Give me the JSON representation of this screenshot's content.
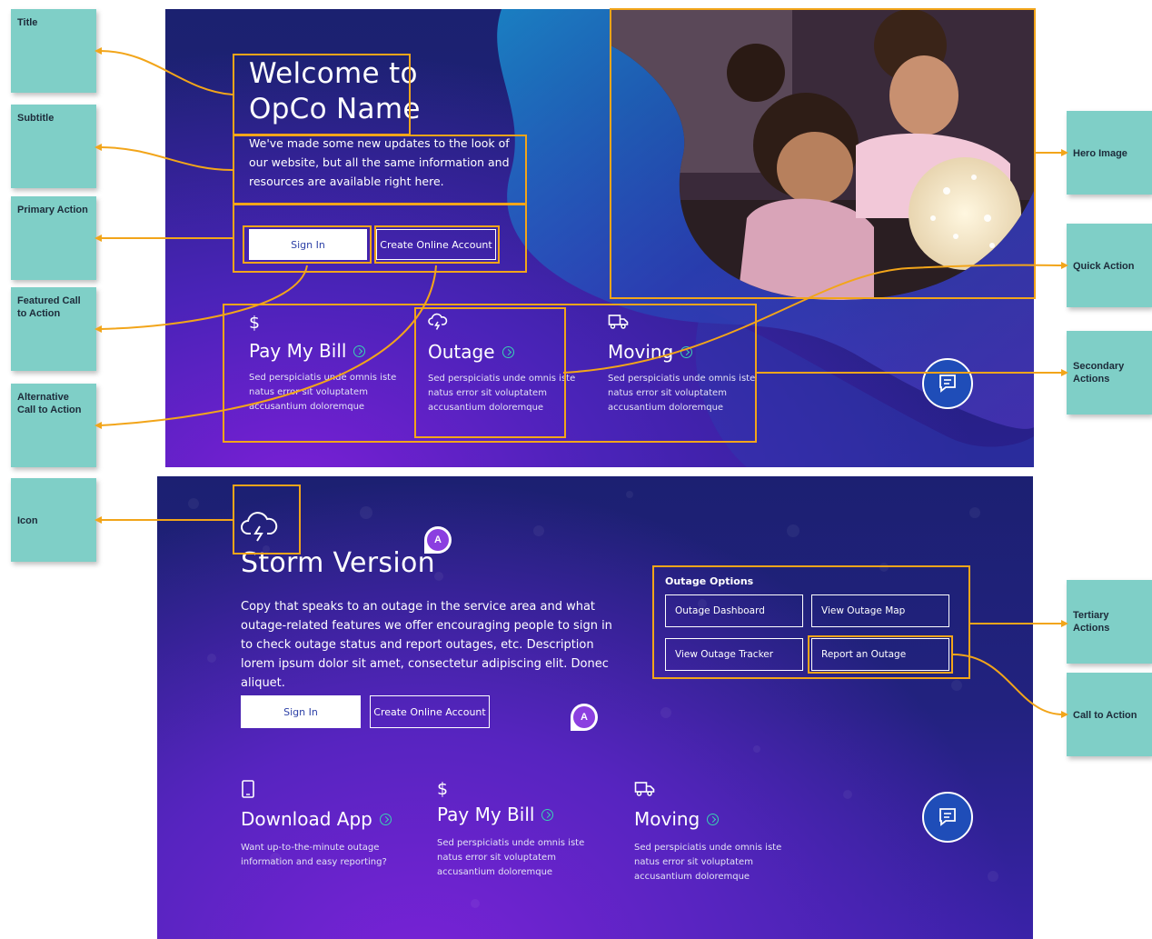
{
  "notes": {
    "title": "Title",
    "subtitle": "Subtitle",
    "primary_action": "Primary Action",
    "featured_cta": "Featured Call to Action",
    "alternative_cta": "Alternative Call to Action",
    "icon": "Icon",
    "hero_image": "Hero Image",
    "quick_action": "Quick Action",
    "secondary_actions": "Secondary Actions",
    "tertiary_actions": "Tertiary Actions",
    "call_to_action": "Call to Action"
  },
  "top": {
    "title_line1": "Welcome to",
    "title_line2": "OpCo Name",
    "subtitle": "We've made some new updates to the look of our website, but all the same information and resources are available right here.",
    "sign_in": "Sign In",
    "create_account": "Create Online Account",
    "cards": [
      {
        "icon": "dollar-icon",
        "title": "Pay My Bill",
        "desc": "Sed perspiciatis unde omnis iste natus error sit voluptatem accusantium doloremque"
      },
      {
        "icon": "storm-cloud-icon",
        "title": "Outage",
        "desc": "Sed perspiciatis unde omnis iste natus error sit voluptatem accusantium doloremque"
      },
      {
        "icon": "truck-icon",
        "title": "Moving",
        "desc": "Sed perspiciatis unde omnis iste natus error sit voluptatem accusantium doloremque"
      }
    ]
  },
  "bottom": {
    "title": "Storm Version",
    "description": "Copy that speaks to an outage in the service area and what outage-related features we offer encouraging people to sign in to check outage status and report outages, etc. Description lorem ipsum dolor sit amet, consectetur adipiscing elit. Donec aliquet.",
    "sign_in": "Sign In",
    "create_account": "Create Online Account",
    "avatar_letter": "A",
    "outage_options": {
      "heading": "Outage Options",
      "buttons": [
        "Outage Dashboard",
        "View Outage Map",
        "View Outage Tracker",
        "Report an Outage"
      ]
    },
    "cards": [
      {
        "icon": "phone-icon",
        "title": "Download App",
        "desc": "Want up-to-the-minute outage information and easy reporting?"
      },
      {
        "icon": "dollar-icon",
        "title": "Pay My Bill",
        "desc": "Sed perspiciatis unde omnis iste natus error sit voluptatem accusantium doloremque"
      },
      {
        "icon": "truck-icon",
        "title": "Moving",
        "desc": "Sed perspiciatis unde omnis iste natus error sit voluptatem accusantium doloremque"
      }
    ]
  },
  "colors": {
    "annotation": "#f2a51a",
    "note": "#7fcfc7",
    "accent_teal": "#3ad1b4",
    "panel_navy": "#1b2170",
    "panel_purple": "#7a1fd6",
    "chat_blue": "#1f4db8"
  }
}
